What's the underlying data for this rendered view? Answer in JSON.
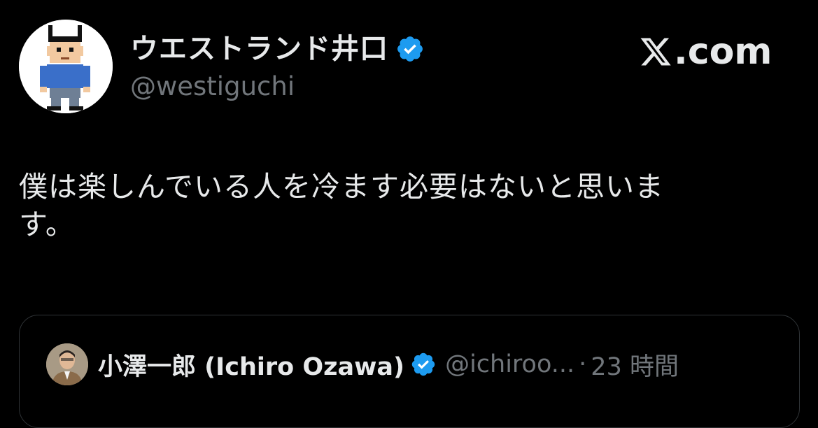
{
  "author": {
    "display_name": "ウエストランド井口",
    "handle": "@westiguchi",
    "avatar_icon": "pixel-art-person-avatar",
    "verified_color": "#1d9bf0"
  },
  "brand": {
    "label": ".com",
    "logo_icon": "x-logo-icon"
  },
  "tweet": {
    "text": "僕は楽しんでいる人を冷ます必要はないと思いま\nす。"
  },
  "quote": {
    "display_name": "小澤一郎 (Ichiro Ozawa)",
    "handle": "@ichiroo...",
    "separator": "·",
    "time": "23 時間",
    "avatar_icon": "profile-photo-avatar"
  },
  "colors": {
    "background": "#000000",
    "text_primary": "#e7e9ea",
    "text_secondary": "#71767b",
    "border": "#2f3336"
  }
}
